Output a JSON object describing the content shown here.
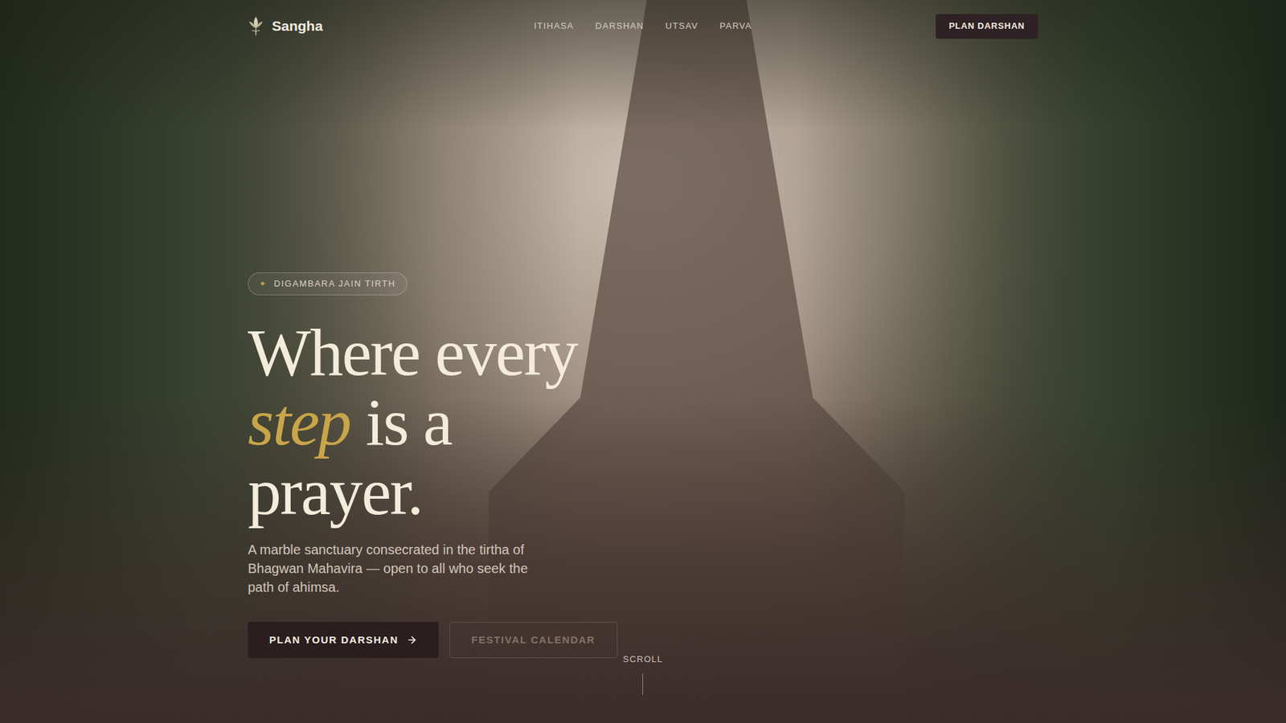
{
  "brand": {
    "name": "Sangha"
  },
  "nav": {
    "links": [
      "ITIHASA",
      "DARSHAN",
      "UTSAV",
      "PARVA"
    ],
    "cta": "PLAN DARSHAN"
  },
  "hero": {
    "badge": {
      "icon": "✦",
      "label": "DIGAMBARA JAIN TIRTH"
    },
    "heading": {
      "line1": "Where every",
      "accent": "step",
      "rest": "is a",
      "line3": "prayer."
    },
    "description": "A marble sanctuary consecrated in the tirtha of Bhagwan Mahavira — open to all who seek the path of ahimsa.",
    "buttons": [
      {
        "label": "PLAN YOUR DARSHAN",
        "kind": "primary"
      },
      {
        "label": "FESTIVAL CALENDAR",
        "kind": "secondary"
      }
    ],
    "scroll": "SCROLL"
  }
}
